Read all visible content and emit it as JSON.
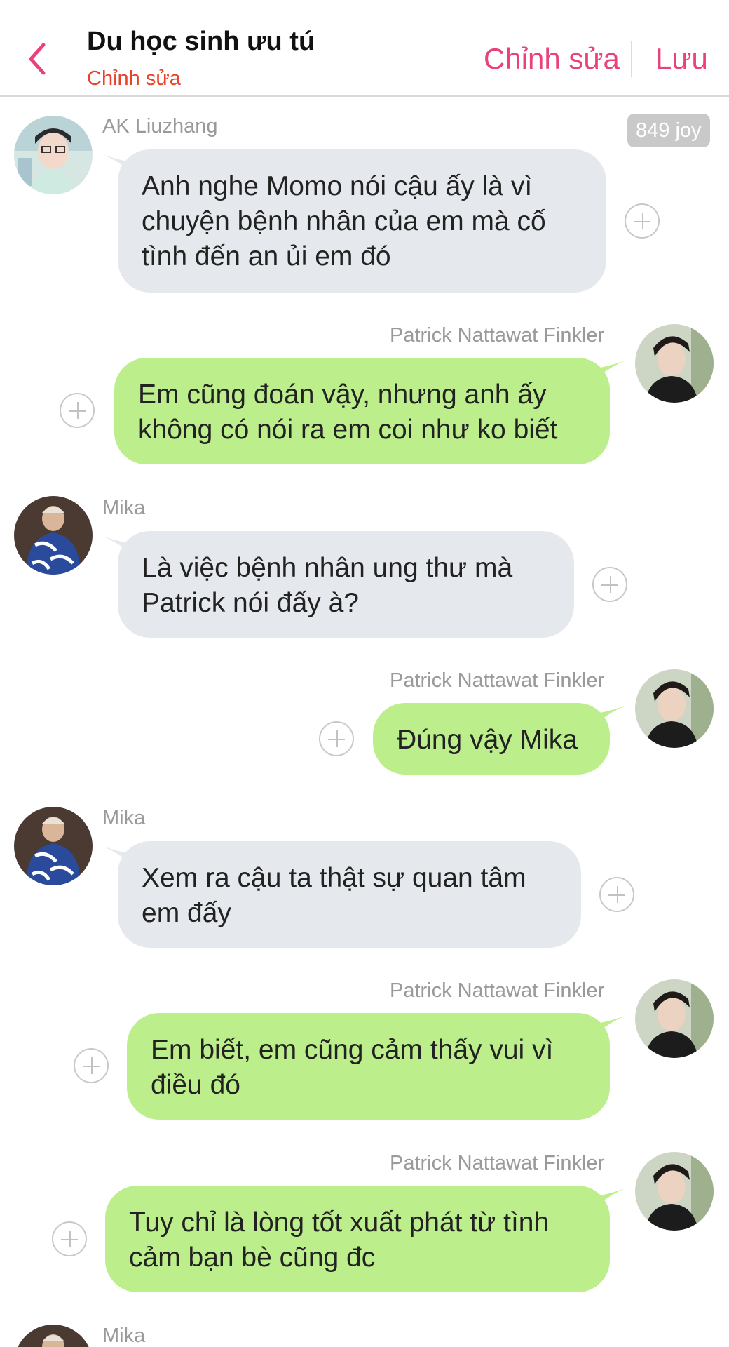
{
  "header": {
    "title": "Du học sinh ưu tú",
    "subtitle": "Chỉnh sửa",
    "edit_label": "Chỉnh sửa",
    "save_label": "Lưu",
    "back_icon": "chevron-left-icon"
  },
  "joy_badge": "849 joy",
  "messages": [
    {
      "sender": "AK Liuzhang",
      "side": "left",
      "text": "Anh nghe Momo nói cậu ấy là vì chuyện bệnh nhân của em mà cố tình đến an ủi em đó"
    },
    {
      "sender": "Patrick Nattawat Finkler",
      "side": "right",
      "text": "Em cũng đoán vậy, nhưng anh ấy không có nói ra em coi như ko biết"
    },
    {
      "sender": "Mika",
      "side": "left",
      "text": "Là việc bệnh nhân ung thư  mà Patrick nói đấy à?"
    },
    {
      "sender": "Patrick Nattawat Finkler",
      "side": "right",
      "text": "Đúng vậy Mika"
    },
    {
      "sender": "Mika",
      "side": "left",
      "text": "Xem ra cậu ta thật sự quan tâm em đấy"
    },
    {
      "sender": "Patrick Nattawat Finkler",
      "side": "right",
      "text": "Em biết, em cũng cảm thấy vui vì điều đó"
    },
    {
      "sender": "Patrick Nattawat Finkler",
      "side": "right",
      "text": "Tuy chỉ là lòng tốt xuất phát từ tình cảm bạn bè cũng đc"
    },
    {
      "sender": "Mika",
      "side": "left",
      "text": ""
    }
  ],
  "colors": {
    "accent_pink": "#e8417c",
    "subtitle_red": "#e8422a",
    "left_bubble": "#e5e8ec",
    "right_bubble": "#bdee8c"
  }
}
